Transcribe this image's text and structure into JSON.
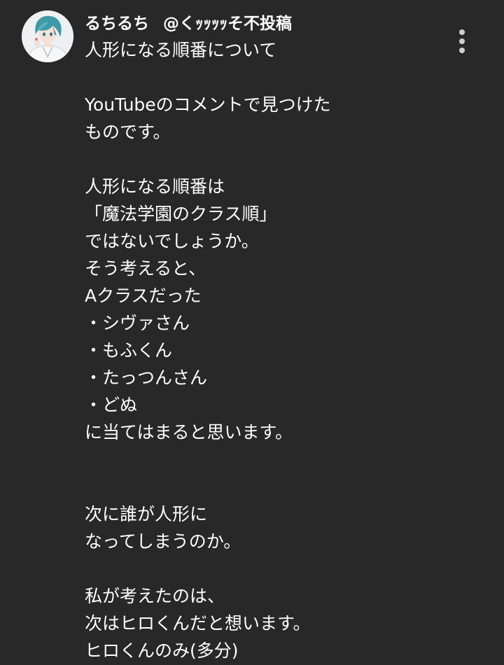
{
  "comment": {
    "author": "るちるち",
    "handle": "@くｯｯｯｯそ不投稿",
    "avatar_icon": "user-avatar-icon",
    "menu_icon": "more-vertical-icon",
    "lines": [
      "人形になる順番について",
      "",
      "YouTubeのコメントで見つけた",
      "ものです。",
      "",
      "人形になる順番は",
      "「魔法学園のクラス順」",
      "ではないでしょうか。",
      "そう考えると、",
      "Aクラスだった",
      "・シヴァさん",
      "・もふくん",
      "・たっつんさん",
      "・どぬ",
      "に当てはまると思います。",
      "",
      "",
      "次に誰が人形に",
      "なってしまうのか。",
      "",
      "私が考えたのは、",
      "次はヒロくんだと想います。",
      "ヒロくんのみ(多分)"
    ]
  },
  "colors": {
    "background": "#282828",
    "text": "#ffffff",
    "menu_dots": "#cfcfcf"
  }
}
